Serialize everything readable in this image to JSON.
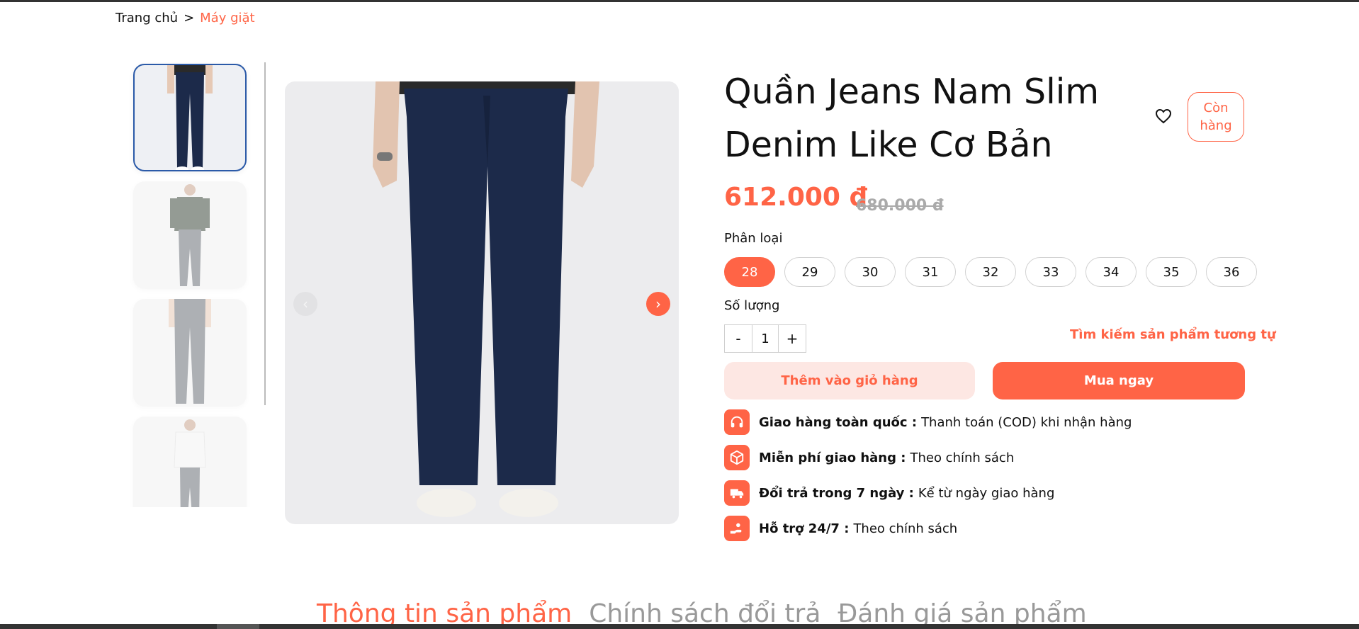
{
  "breadcrumb": {
    "home": "Trang chủ",
    "separator": ">",
    "current": "Máy giặt"
  },
  "product": {
    "title_line1": "Quần Jeans Nam Slim",
    "title_line2": "Denim Like Cơ Bản",
    "stock_line1": "Còn",
    "stock_line2": "hàng",
    "price": "612.000 đ",
    "old_price": "680.000 đ"
  },
  "variant": {
    "label": "Phân loại",
    "options": [
      "28",
      "29",
      "30",
      "31",
      "32",
      "33",
      "34",
      "35",
      "36"
    ],
    "selected": "28"
  },
  "quantity": {
    "label": "Số lượng",
    "minus": "-",
    "value": "1",
    "plus": "+"
  },
  "links": {
    "similar": "Tìm kiếm sản phẩm tương tự"
  },
  "actions": {
    "add_to_cart": "Thêm vào giỏ hàng",
    "buy_now": "Mua ngay"
  },
  "features": [
    {
      "icon": "headphones-icon",
      "title": "Giao hàng toàn quốc :",
      "text": "Thanh toán (COD) khi nhận hàng"
    },
    {
      "icon": "box-icon",
      "title": "Miễn phí giao hàng :",
      "text": "Theo chính sách"
    },
    {
      "icon": "truck-icon",
      "title": "Đổi trả trong 7 ngày :",
      "text": "Kể từ ngày giao hàng"
    },
    {
      "icon": "hand-support-icon",
      "title": "Hỗ trợ 24/7 :",
      "text": "Theo chính sách"
    }
  ],
  "tabs": [
    "Thông tin sản phẩm",
    "Chính sách đổi trả",
    "Đánh giá sản phẩm"
  ],
  "colors": {
    "accent": "#ff6446",
    "accent_light": "#fde7e3",
    "thumb_active_border": "#2b5aa8",
    "jeans_navy": "#1c2a4a",
    "jeans_gray": "#6b7078"
  }
}
